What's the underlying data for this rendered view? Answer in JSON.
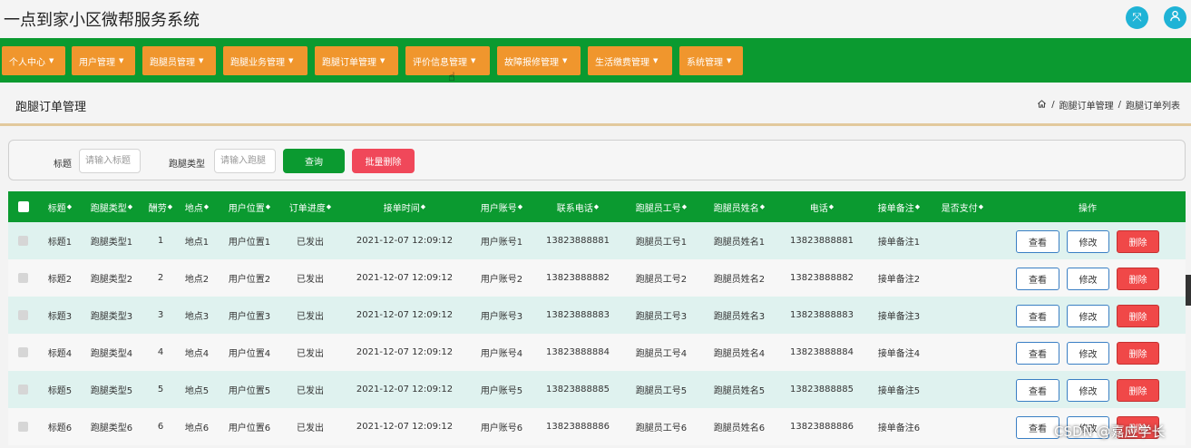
{
  "app": {
    "title": "一点到家小区微帮服务系统"
  },
  "nav": [
    "个人中心",
    "用户管理",
    "跑腿员管理",
    "跑腿业务管理",
    "跑腿订单管理",
    "评价信息管理",
    "故障报修管理",
    "生活缴费管理",
    "系统管理"
  ],
  "page": {
    "title": "跑腿订单管理",
    "breadcrumb": [
      "跑腿订单管理",
      "跑腿订单列表"
    ]
  },
  "search": {
    "title_label": "标题",
    "title_placeholder": "请输入标题",
    "type_label": "跑腿类型",
    "type_placeholder": "请输入跑腿",
    "query_label": "查询",
    "batch_delete_label": "批量删除"
  },
  "table": {
    "headers": [
      "标题",
      "跑腿类型",
      "酬劳",
      "地点",
      "用户位置",
      "订单进度",
      "接单时间",
      "用户账号",
      "联系电话",
      "跑腿员工号",
      "跑腿员姓名",
      "电话",
      "接单备注",
      "是否支付",
      "操作"
    ],
    "rows": [
      [
        "标题1",
        "跑腿类型1",
        "1",
        "地点1",
        "用户位置1",
        "已发出",
        "2021-12-07 12:09:12",
        "用户账号1",
        "13823888881",
        "跑腿员工号1",
        "跑腿员姓名1",
        "13823888881",
        "接单备注1"
      ],
      [
        "标题2",
        "跑腿类型2",
        "2",
        "地点2",
        "用户位置2",
        "已发出",
        "2021-12-07 12:09:12",
        "用户账号2",
        "13823888882",
        "跑腿员工号2",
        "跑腿员姓名2",
        "13823888882",
        "接单备注2"
      ],
      [
        "标题3",
        "跑腿类型3",
        "3",
        "地点3",
        "用户位置3",
        "已发出",
        "2021-12-07 12:09:12",
        "用户账号3",
        "13823888883",
        "跑腿员工号3",
        "跑腿员姓名3",
        "13823888883",
        "接单备注3"
      ],
      [
        "标题4",
        "跑腿类型4",
        "4",
        "地点4",
        "用户位置4",
        "已发出",
        "2021-12-07 12:09:12",
        "用户账号4",
        "13823888884",
        "跑腿员工号4",
        "跑腿员姓名4",
        "13823888884",
        "接单备注4"
      ],
      [
        "标题5",
        "跑腿类型5",
        "5",
        "地点5",
        "用户位置5",
        "已发出",
        "2021-12-07 12:09:12",
        "用户账号5",
        "13823888885",
        "跑腿员工号5",
        "跑腿员姓名5",
        "13823888885",
        "接单备注5"
      ],
      [
        "标题6",
        "跑腿类型6",
        "6",
        "地点6",
        "用户位置6",
        "已发出",
        "2021-12-07 12:09:12",
        "用户账号6",
        "13823888886",
        "跑腿员工号6",
        "跑腿员姓名6",
        "13823888886",
        "接单备注6"
      ]
    ],
    "actions": {
      "view": "查看",
      "edit": "修改",
      "delete": "删除"
    }
  },
  "watermark": "CSDN @嘉应学长",
  "colors": {
    "nav_bg": "#0b9a30",
    "nav_item": "#f0962d",
    "danger": "#f04848",
    "accent": "#1fb3d6",
    "row_alt": "#dff2ef"
  }
}
